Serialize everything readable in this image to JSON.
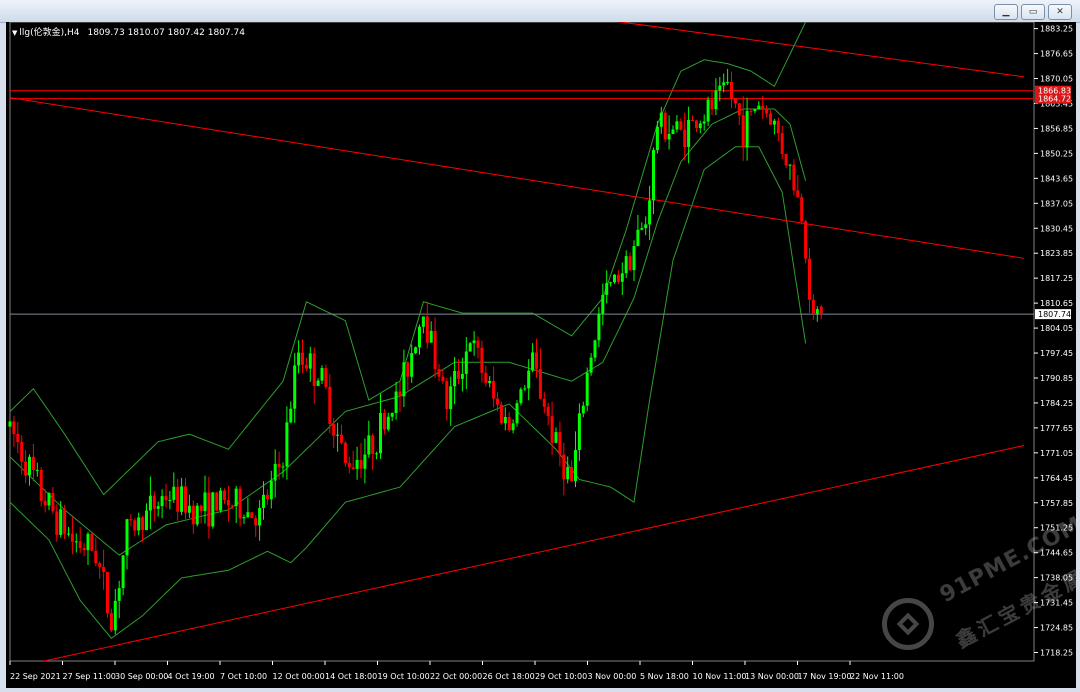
{
  "window": {
    "buttons": {
      "minimize": "▁",
      "restore": "▭",
      "close": "✕"
    }
  },
  "chart": {
    "caption": {
      "symbol": "llg(伦敦金),H4",
      "ohlc": "1809.73 1810.07 1807.42 1807.74"
    },
    "current_price_label": "1807.74",
    "pending_labels": [
      "1866.83",
      "1864.72"
    ]
  },
  "watermark": {
    "line1": "91PME.COM",
    "line2": "鑫汇宝贵金属"
  },
  "colors": {
    "background": "#000000",
    "bull": "#00ff00",
    "bear": "#ff0000",
    "bands": "#2e9e2e",
    "trendline": "#ff0000",
    "axis_text": "#ffffff"
  },
  "chart_data": {
    "type": "candlestick",
    "title": "llg(伦敦金),H4",
    "x_tick_labels": [
      "22 Sep 2021",
      "27 Sep 11:00",
      "30 Sep 00:00",
      "4 Oct 19:00",
      "7 Oct 10:00",
      "12 Oct 00:00",
      "14 Oct 18:00",
      "19 Oct 10:00",
      "22 Oct 00:00",
      "26 Oct 18:00",
      "29 Oct 10:00",
      "3 Nov 00:00",
      "5 Nov 18:00",
      "10 Nov 11:00",
      "13 Nov 00:00",
      "17 Nov 19:00",
      "22 Nov 11:00"
    ],
    "y_tick_labels": [
      1883.25,
      1876.65,
      1870.05,
      1863.45,
      1856.85,
      1850.25,
      1843.65,
      1837.05,
      1830.45,
      1823.85,
      1817.25,
      1810.65,
      1804.05,
      1797.45,
      1790.85,
      1784.25,
      1777.65,
      1771.05,
      1764.45,
      1757.85,
      1751.25,
      1744.65,
      1738.05,
      1731.45,
      1724.85,
      1718.25
    ],
    "ylim": [
      1716,
      1885
    ],
    "last_price": 1807.74,
    "last_ohlc": {
      "open": 1809.73,
      "high": 1810.07,
      "low": 1807.42,
      "close": 1807.74
    },
    "horizontal_levels": [
      1866.83,
      1864.72
    ],
    "close_path": [
      {
        "i": 0,
        "v": 1778
      },
      {
        "i": 8,
        "v": 1760
      },
      {
        "i": 16,
        "v": 1748
      },
      {
        "i": 22,
        "v": 1745
      },
      {
        "i": 26,
        "v": 1726
      },
      {
        "i": 30,
        "v": 1750
      },
      {
        "i": 40,
        "v": 1760
      },
      {
        "i": 48,
        "v": 1756
      },
      {
        "i": 56,
        "v": 1758
      },
      {
        "i": 64,
        "v": 1754
      },
      {
        "i": 70,
        "v": 1770
      },
      {
        "i": 74,
        "v": 1798
      },
      {
        "i": 80,
        "v": 1790
      },
      {
        "i": 86,
        "v": 1768
      },
      {
        "i": 92,
        "v": 1772
      },
      {
        "i": 100,
        "v": 1787
      },
      {
        "i": 106,
        "v": 1809
      },
      {
        "i": 112,
        "v": 1784
      },
      {
        "i": 118,
        "v": 1801
      },
      {
        "i": 124,
        "v": 1785
      },
      {
        "i": 128,
        "v": 1778
      },
      {
        "i": 134,
        "v": 1795
      },
      {
        "i": 140,
        "v": 1773
      },
      {
        "i": 144,
        "v": 1763
      },
      {
        "i": 148,
        "v": 1792
      },
      {
        "i": 152,
        "v": 1812
      },
      {
        "i": 158,
        "v": 1822
      },
      {
        "i": 163,
        "v": 1832
      },
      {
        "i": 166,
        "v": 1858
      },
      {
        "i": 172,
        "v": 1856
      },
      {
        "i": 178,
        "v": 1860
      },
      {
        "i": 184,
        "v": 1868
      },
      {
        "i": 188,
        "v": 1857
      },
      {
        "i": 192,
        "v": 1864
      },
      {
        "i": 196,
        "v": 1858
      },
      {
        "i": 200,
        "v": 1846
      },
      {
        "i": 203,
        "v": 1834
      },
      {
        "i": 206,
        "v": 1806
      },
      {
        "i": 208,
        "v": 1808
      }
    ],
    "upper_band": [
      {
        "i": 0,
        "v": 1782
      },
      {
        "i": 6,
        "v": 1788
      },
      {
        "i": 14,
        "v": 1776
      },
      {
        "i": 24,
        "v": 1760
      },
      {
        "i": 30,
        "v": 1766
      },
      {
        "i": 38,
        "v": 1774
      },
      {
        "i": 46,
        "v": 1776
      },
      {
        "i": 56,
        "v": 1772
      },
      {
        "i": 70,
        "v": 1790
      },
      {
        "i": 76,
        "v": 1811
      },
      {
        "i": 86,
        "v": 1806
      },
      {
        "i": 92,
        "v": 1785
      },
      {
        "i": 100,
        "v": 1790
      },
      {
        "i": 106,
        "v": 1811
      },
      {
        "i": 116,
        "v": 1808
      },
      {
        "i": 124,
        "v": 1808
      },
      {
        "i": 134,
        "v": 1808
      },
      {
        "i": 144,
        "v": 1802
      },
      {
        "i": 152,
        "v": 1812
      },
      {
        "i": 158,
        "v": 1830
      },
      {
        "i": 166,
        "v": 1858
      },
      {
        "i": 172,
        "v": 1872
      },
      {
        "i": 178,
        "v": 1875
      },
      {
        "i": 184,
        "v": 1874
      },
      {
        "i": 190,
        "v": 1872
      },
      {
        "i": 196,
        "v": 1868
      },
      {
        "i": 204,
        "v": 1885
      }
    ],
    "middle_band": [
      {
        "i": 0,
        "v": 1770
      },
      {
        "i": 14,
        "v": 1756
      },
      {
        "i": 28,
        "v": 1744
      },
      {
        "i": 40,
        "v": 1752
      },
      {
        "i": 56,
        "v": 1756
      },
      {
        "i": 70,
        "v": 1766
      },
      {
        "i": 86,
        "v": 1782
      },
      {
        "i": 100,
        "v": 1786
      },
      {
        "i": 114,
        "v": 1795
      },
      {
        "i": 128,
        "v": 1795
      },
      {
        "i": 144,
        "v": 1790
      },
      {
        "i": 152,
        "v": 1795
      },
      {
        "i": 160,
        "v": 1812
      },
      {
        "i": 166,
        "v": 1832
      },
      {
        "i": 172,
        "v": 1848
      },
      {
        "i": 180,
        "v": 1858
      },
      {
        "i": 188,
        "v": 1862
      },
      {
        "i": 196,
        "v": 1862
      },
      {
        "i": 200,
        "v": 1858
      },
      {
        "i": 204,
        "v": 1843
      }
    ],
    "lower_band": [
      {
        "i": 0,
        "v": 1758
      },
      {
        "i": 10,
        "v": 1748
      },
      {
        "i": 18,
        "v": 1732
      },
      {
        "i": 26,
        "v": 1722
      },
      {
        "i": 34,
        "v": 1728
      },
      {
        "i": 44,
        "v": 1738
      },
      {
        "i": 56,
        "v": 1740
      },
      {
        "i": 66,
        "v": 1745
      },
      {
        "i": 72,
        "v": 1742
      },
      {
        "i": 76,
        "v": 1746
      },
      {
        "i": 86,
        "v": 1758
      },
      {
        "i": 100,
        "v": 1762
      },
      {
        "i": 114,
        "v": 1778
      },
      {
        "i": 128,
        "v": 1784
      },
      {
        "i": 140,
        "v": 1772
      },
      {
        "i": 146,
        "v": 1764
      },
      {
        "i": 154,
        "v": 1762
      },
      {
        "i": 160,
        "v": 1758
      },
      {
        "i": 164,
        "v": 1785
      },
      {
        "i": 170,
        "v": 1822
      },
      {
        "i": 178,
        "v": 1846
      },
      {
        "i": 186,
        "v": 1852
      },
      {
        "i": 192,
        "v": 1852
      },
      {
        "i": 198,
        "v": 1840
      },
      {
        "i": 204,
        "v": 1800
      }
    ],
    "trendlines": [
      {
        "name": "upper-trend",
        "from": {
          "i": 14,
          "v": 1905
        },
        "to": {
          "i": 260,
          "v": 1870.5
        }
      },
      {
        "name": "middle-trend",
        "from": {
          "i": 0,
          "v": 1865
        },
        "to": {
          "i": 260,
          "v": 1822.5
        }
      },
      {
        "name": "lower-trend",
        "from": {
          "i": 0,
          "v": 1714
        },
        "to": {
          "i": 260,
          "v": 1773
        }
      }
    ]
  }
}
